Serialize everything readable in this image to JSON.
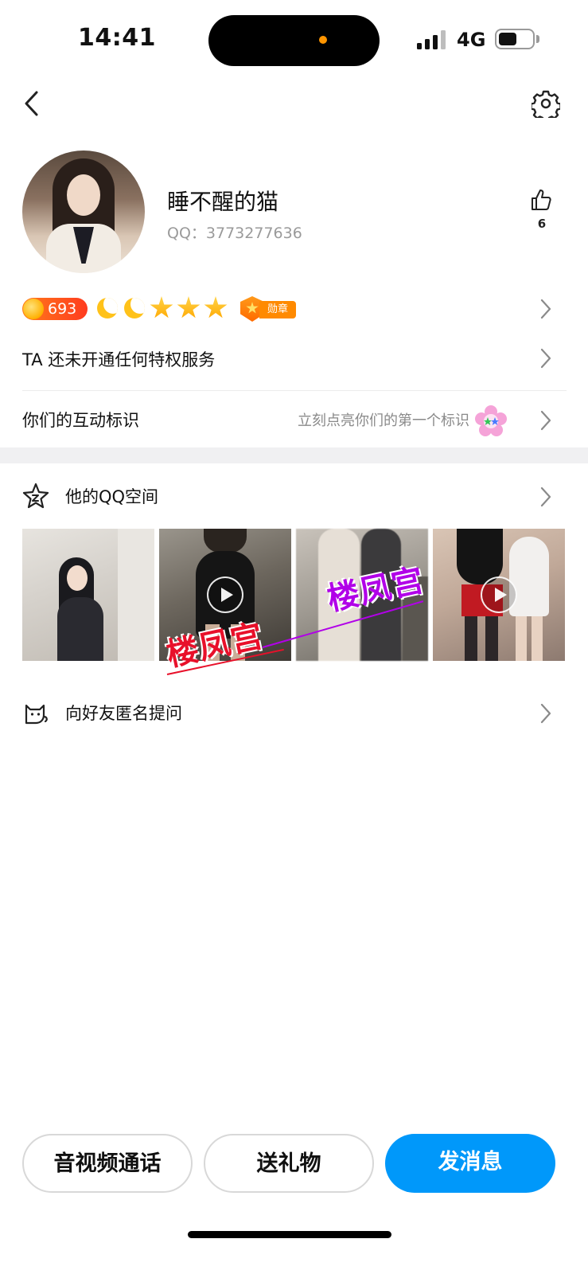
{
  "status_bar": {
    "time": "14:41",
    "network": "4G"
  },
  "profile": {
    "nickname": "睡不醒的猫",
    "qq_label": "QQ：",
    "qq_number": "3773277636",
    "like_count": "6"
  },
  "level": {
    "number": "693",
    "medal_label": "勋章"
  },
  "rows": {
    "privilege": "TA 还未开通任何特权服务",
    "interaction_label": "你们的互动标识",
    "interaction_hint": "立刻点亮你们的第一个标识",
    "qzone": "他的QQ空间",
    "anonymous": "向好友匿名提问"
  },
  "watermarks": [
    "楼凤宫",
    "楼凤宫"
  ],
  "buttons": {
    "call": "音视频通话",
    "gift": "送礼物",
    "message": "发消息"
  },
  "colors": {
    "primary": "#0098fa",
    "level_badge": "#ff3b1f",
    "star": "#ffc21a",
    "watermark_red": "#e8102a",
    "watermark_purple": "#b100e8"
  },
  "icons": [
    "back-icon",
    "gear-icon",
    "thumbs-up-icon",
    "chevron-right-icon",
    "star-badge-icon",
    "cat-icon",
    "flower-icon",
    "play-icon"
  ]
}
